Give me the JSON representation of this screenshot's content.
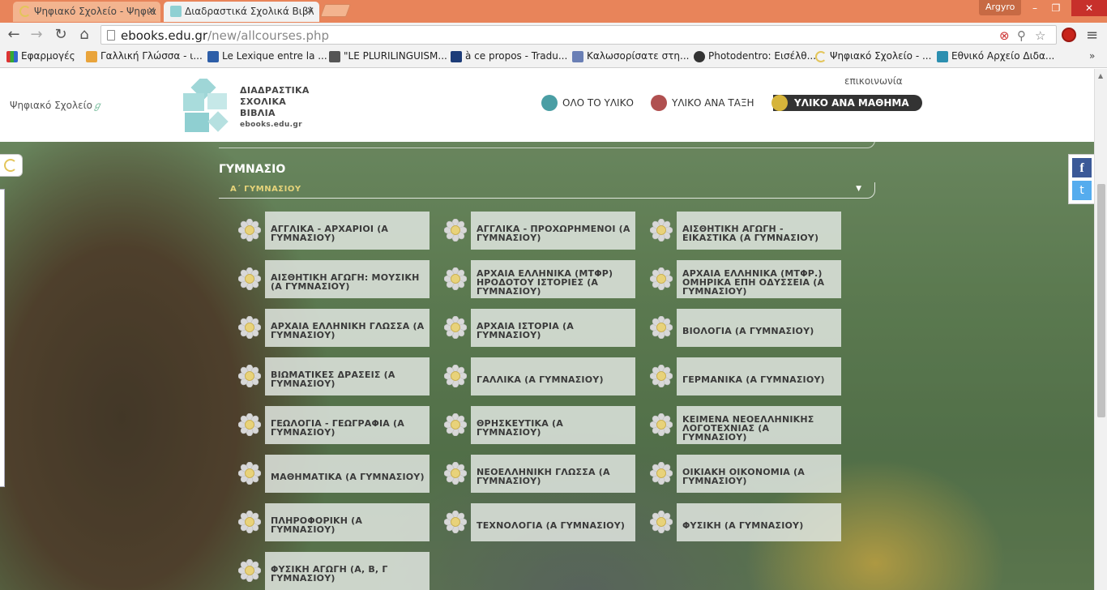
{
  "browser": {
    "tabs": [
      {
        "title": "Ψηφιακό Σχολείο - Ψηφια",
        "active": false
      },
      {
        "title": "Διαδραστικά Σχολικά Βιβλ",
        "active": true
      }
    ],
    "profile": "Argyro",
    "url_host": "ebooks.edu.gr",
    "url_path": "/new/allcourses.php",
    "bookmarks": [
      "Εφαρμογές",
      "Γαλλική Γλώσσα - ι...",
      "Le Lexique entre la ...",
      "\"LE PLURILINGUISM...",
      "à ce propos - Tradu...",
      "Καλωσορίσατε στη...",
      "Photodentro: Εισέλθ...",
      "Ψηφιακό Σχολείο - ...",
      "Εθνικό Αρχείο Διδα..."
    ],
    "bookmarks_more": "»"
  },
  "site": {
    "school_logo": "Ψηφιακό Σχολείο",
    "brand_lines": [
      "ΔΙΑΔΡΑΣΤΙΚΑ",
      "ΣΧΟΛΙΚΑ",
      "ΒΙΒΛΙΑ"
    ],
    "brand_url": "ebooks.edu.gr",
    "contact": "επικοινωνία",
    "nav": [
      {
        "label": "ΟΛΟ ΤΟ ΥΛΙΚΟ",
        "color": "#4a9ea4"
      },
      {
        "label": "ΥΛΙΚΟ ΑΝΑ ΤΑΞΗ",
        "color": "#b05050"
      },
      {
        "label": "ΥΛΙΚΟ ΑΝΑ ΜΑΘΗΜΑ",
        "color": "#d6b43a",
        "active": true
      }
    ]
  },
  "content": {
    "level": "ΓΥΜΝΑΣΙΟ",
    "grade": "Α΄ ΓΥΜΝΑΣΙΟΥ",
    "courses": [
      "ΑΓΓΛΙΚΑ - ΑΡΧΑΡΙΟΙ (Α ΓΥΜΝΑΣΙΟΥ)",
      "ΑΓΓΛΙΚΑ - ΠΡΟΧΩΡΗΜΕΝΟΙ (Α ΓΥΜΝΑΣΙΟΥ)",
      "ΑΙΣΘΗΤΙΚΗ ΑΓΩΓΗ - ΕΙΚΑΣΤΙΚΑ (Α ΓΥΜΝΑΣΙΟΥ)",
      "ΑΙΣΘΗΤΙΚΗ ΑΓΩΓΗ: ΜΟΥΣΙΚΗ (Α ΓΥΜΝΑΣΙΟΥ)",
      "ΑΡΧΑΙΑ ΕΛΛΗΝΙΚΑ (ΜΤΦΡ) ΗΡΟΔΟΤΟΥ ΙΣΤΟΡΙΕΣ (Α ΓΥΜΝΑΣΙΟΥ)",
      "ΑΡΧΑΙΑ ΕΛΛΗΝΙΚΑ (ΜΤΦΡ.) ΟΜΗΡΙΚΑ ΕΠΗ ΟΔΥΣΣΕΙΑ (Α ΓΥΜΝΑΣΙΟΥ)",
      "ΑΡΧΑΙΑ ΕΛΛΗΝΙΚΗ ΓΛΩΣΣΑ (Α ΓΥΜΝΑΣΙΟΥ)",
      "ΑΡΧΑΙΑ ΙΣΤΟΡΙΑ (Α ΓΥΜΝΑΣΙΟΥ)",
      "ΒΙΟΛΟΓΙΑ (Α ΓΥΜΝΑΣΙΟΥ)",
      "ΒΙΩΜΑΤΙΚΕΣ ΔΡΑΣΕΙΣ (Α ΓΥΜΝΑΣΙΟΥ)",
      "ΓΑΛΛΙΚΑ (Α ΓΥΜΝΑΣΙΟΥ)",
      "ΓΕΡΜΑΝΙΚΑ (Α ΓΥΜΝΑΣΙΟΥ)",
      "ΓΕΩΛΟΓΙΑ - ΓΕΩΓΡΑΦΙΑ (Α ΓΥΜΝΑΣΙΟΥ)",
      "ΘΡΗΣΚΕΥΤΙΚΑ (Α ΓΥΜΝΑΣΙΟΥ)",
      "ΚΕΙΜΕΝΑ ΝΕΟΕΛΛΗΝΙΚΗΣ ΛΟΓΟΤΕΧΝΙΑΣ (Α ΓΥΜΝΑΣΙΟΥ)",
      "ΜΑΘΗΜΑΤΙΚΑ (Α ΓΥΜΝΑΣΙΟΥ)",
      "ΝΕΟΕΛΛΗΝΙΚΗ ΓΛΩΣΣΑ (Α ΓΥΜΝΑΣΙΟΥ)",
      "ΟΙΚΙΑΚΗ ΟΙΚΟΝΟΜΙΑ (Α ΓΥΜΝΑΣΙΟΥ)",
      "ΠΛΗΡΟΦΟΡΙΚΗ (Α ΓΥΜΝΑΣΙΟΥ)",
      "ΤΕΧΝΟΛΟΓΙΑ (Α ΓΥΜΝΑΣΙΟΥ)",
      "ΦΥΣΙΚΗ (Α ΓΥΜΝΑΣΙΟΥ)",
      "ΦΥΣΙΚΗ ΑΓΩΓΗ (Α, Β, Γ ΓΥΜΝΑΣΙΟΥ)"
    ]
  },
  "social": {
    "facebook": "f",
    "twitter": "t"
  }
}
